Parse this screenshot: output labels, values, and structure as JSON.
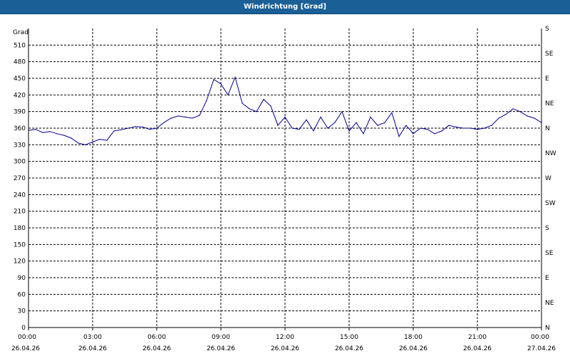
{
  "window": {
    "title": "Windrichtung [Grad]"
  },
  "colors": {
    "titlebar": "#1a5f96",
    "line": "#00008b",
    "grid": "#000000",
    "background": "#ffffff"
  },
  "chart_data": {
    "type": "line",
    "title": "Windrichtung [Grad]",
    "ylabel": "Grad",
    "ylim": [
      0,
      540
    ],
    "yticks": [
      0,
      30,
      60,
      90,
      120,
      150,
      180,
      210,
      240,
      270,
      300,
      330,
      360,
      390,
      420,
      450,
      480,
      510
    ],
    "xlim": [
      "26.04.26 00:00",
      "27.04.26 00:00"
    ],
    "xticks": [
      {
        "time": "00:00",
        "date": "26.04.26"
      },
      {
        "time": "03:00",
        "date": "26.04.26"
      },
      {
        "time": "06:00",
        "date": "26.04.26"
      },
      {
        "time": "09:00",
        "date": "26.04.26"
      },
      {
        "time": "12:00",
        "date": "26.04.26"
      },
      {
        "time": "15:00",
        "date": "26.04.26"
      },
      {
        "time": "18:00",
        "date": "26.04.26"
      },
      {
        "time": "21:00",
        "date": "26.04.26"
      },
      {
        "time": "00:00",
        "date": "27.04.26"
      }
    ],
    "right_axis": [
      {
        "value": 540,
        "label": "S"
      },
      {
        "value": 495,
        "label": "SE"
      },
      {
        "value": 450,
        "label": "E"
      },
      {
        "value": 405,
        "label": "NE"
      },
      {
        "value": 360,
        "label": "N"
      },
      {
        "value": 315,
        "label": "NW"
      },
      {
        "value": 270,
        "label": "W"
      },
      {
        "value": 225,
        "label": "SW"
      },
      {
        "value": 180,
        "label": "S"
      },
      {
        "value": 135,
        "label": "SE"
      },
      {
        "value": 90,
        "label": "E"
      },
      {
        "value": 45,
        "label": "NE"
      },
      {
        "value": 0,
        "label": "N"
      }
    ],
    "grid": true,
    "series": [
      {
        "x": [
          "00:00",
          "00:20",
          "00:40",
          "01:00",
          "01:20",
          "01:40",
          "02:00",
          "02:20",
          "02:40",
          "03:00",
          "03:20",
          "03:40",
          "04:00",
          "04:20",
          "04:40",
          "05:00",
          "05:20",
          "05:40",
          "06:00",
          "06:20",
          "06:40",
          "07:00",
          "07:20",
          "07:40",
          "08:00",
          "08:20",
          "08:40",
          "09:00",
          "09:20",
          "09:40",
          "10:00",
          "10:20",
          "10:40",
          "11:00",
          "11:20",
          "11:40",
          "12:00",
          "12:20",
          "12:40",
          "13:00",
          "13:20",
          "13:40",
          "14:00",
          "14:20",
          "14:40",
          "15:00",
          "15:20",
          "15:40",
          "16:00",
          "16:20",
          "16:40",
          "17:00",
          "17:20",
          "17:40",
          "18:00",
          "18:20",
          "18:40",
          "19:00",
          "19:20",
          "19:40",
          "20:00",
          "20:20",
          "20:40",
          "21:00",
          "21:20",
          "21:40",
          "22:00",
          "22:20",
          "22:40",
          "23:00",
          "23:20",
          "23:40",
          "24:00"
        ],
        "values": [
          356,
          358,
          352,
          354,
          350,
          347,
          342,
          333,
          330,
          335,
          340,
          338,
          355,
          357,
          360,
          363,
          362,
          358,
          360,
          370,
          378,
          382,
          380,
          378,
          383,
          410,
          448,
          440,
          420,
          452,
          405,
          395,
          390,
          412,
          400,
          365,
          380,
          360,
          358,
          375,
          355,
          380,
          360,
          370,
          390,
          355,
          370,
          350,
          380,
          365,
          370,
          388,
          345,
          365,
          350,
          360,
          358,
          350,
          355,
          365,
          362,
          360,
          360,
          358,
          360,
          365,
          378,
          385,
          395,
          390,
          382,
          378,
          370
        ]
      }
    ]
  }
}
